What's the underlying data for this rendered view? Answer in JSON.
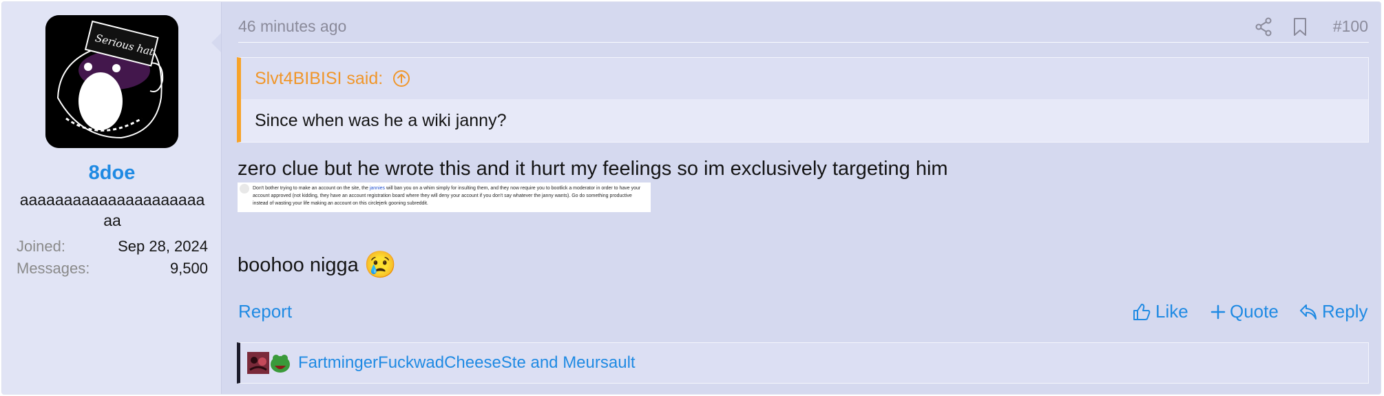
{
  "user": {
    "name": "8doe",
    "title": "aaaaaaaaaaaaaaaaaaaaaaa",
    "avatar_text": "Serious hat",
    "stats": [
      {
        "label": "Joined:",
        "value": "Sep 28, 2024"
      },
      {
        "label": "Messages:",
        "value": "9,500"
      }
    ]
  },
  "post": {
    "time": "46 minutes ago",
    "number": "#100",
    "quote": {
      "author": "Slvt4BIBISI said:",
      "text": "Since when was he a wiki janny?"
    },
    "body_text": "zero clue but he wrote this and it hurt my feelings so im exclusively targeting him",
    "embedded": {
      "before": "Don't bother trying to make an account on the site, the",
      "link": "jannies",
      "after": "will ban you on a whim simply for insulting them, and they now require you to bootlick a moderator in order to have your account approved (not kidding, they have an account registration board where they will deny your account if you don't say whatever the janny wants). Go do something productive instead of wasting your life making an account on this circlejerk gooning subreddit."
    },
    "body_text2": "boohoo nigga",
    "emoji": "😢"
  },
  "actions": {
    "report": "Report",
    "like": "Like",
    "quote": "Quote",
    "reply": "Reply"
  },
  "reactions": {
    "names": "FartmingerFuckwadCheeseSte and Meursault"
  },
  "colors": {
    "accent": "#1f8ae3",
    "quote_border": "#f7a32a",
    "quote_author": "#f0962a"
  }
}
